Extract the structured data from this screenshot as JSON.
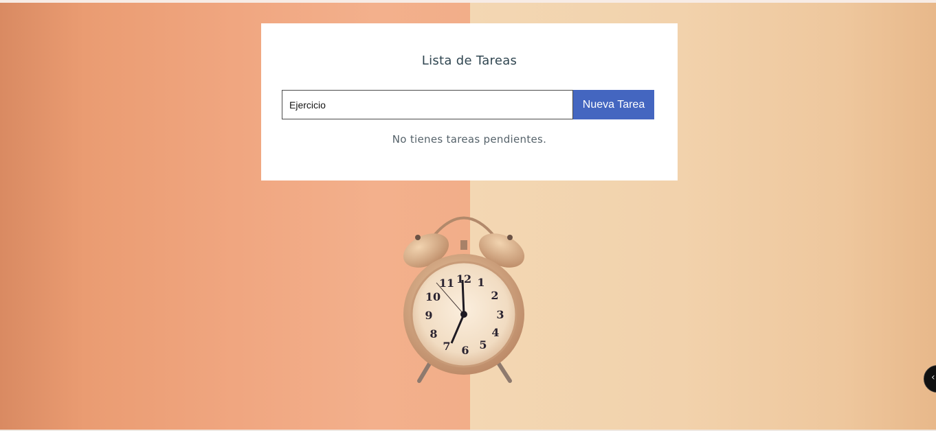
{
  "app": {
    "title": "Lista de Tareas"
  },
  "form": {
    "input_value": "Ejercicio",
    "button_label": "Nueva Tarea"
  },
  "tasks": {
    "empty_message": "No tienes tareas pendientes."
  },
  "floating_button": {
    "icon": "chevron-left-icon",
    "glyph": "‹"
  },
  "clock": {
    "numerals": [
      "12",
      "1",
      "2",
      "3",
      "4",
      "5",
      "6",
      "7",
      "8",
      "9",
      "10",
      "11"
    ]
  },
  "colors": {
    "button": "#4466c0",
    "card": "#ffffff",
    "background_left": "#f0a680",
    "background_right": "#f2d2ac"
  }
}
